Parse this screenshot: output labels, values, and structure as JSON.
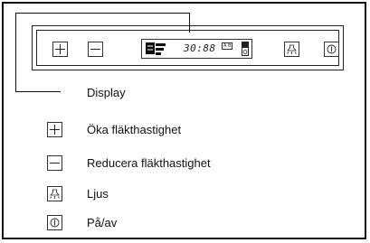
{
  "legend": {
    "display": "Display",
    "increase": "Öka fläkthastighet",
    "decrease": "Reducera fläkthastighet",
    "light": "Ljus",
    "power": "På/av"
  },
  "panel": {
    "time": "30:88",
    "badge": "A B",
    "icons": [
      "plus-icon",
      "minus-icon",
      "fan-level-icon",
      "lamp-icon",
      "power-icon"
    ]
  }
}
